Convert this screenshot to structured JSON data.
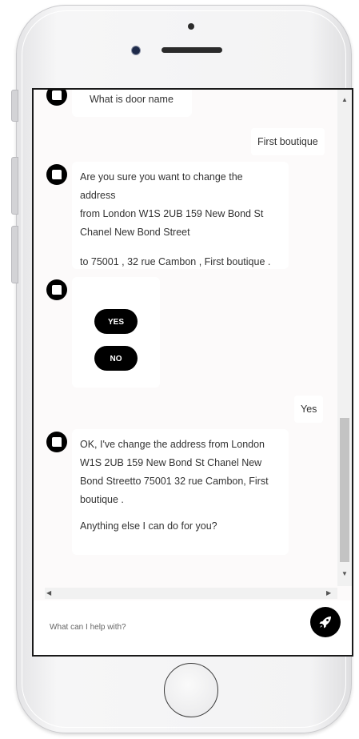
{
  "messages": {
    "bot_question": "What is door name",
    "user_answer": "First boutique",
    "bot_confirm_line1": "Are you sure you want to change the address",
    "bot_confirm_line2": "from London W1S 2UB 159 New Bond St",
    "bot_confirm_line3": "Chanel New Bond Street",
    "bot_confirm_line4": "to 75001 , 32 rue Cambon , First boutique .",
    "user_yes": "Yes",
    "bot_done_line1": "OK, I've change the address from London",
    "bot_done_line2": "W1S 2UB 159 New Bond St Chanel New",
    "bot_done_line3": "Bond Streetto 75001  32 rue Cambon, First",
    "bot_done_line4": "boutique .",
    "bot_done_line5": "Anything else I can do for you?"
  },
  "quick_replies": {
    "yes_label": "YES",
    "no_label": "NO"
  },
  "input": {
    "placeholder": "What can I help with?",
    "value": ""
  },
  "icons": {
    "avatar": "chat-bubble-icon",
    "send": "rocket-icon"
  },
  "colors": {
    "accent": "#000000",
    "chat_background": "#fcfafa",
    "bubble": "#ffffff"
  }
}
